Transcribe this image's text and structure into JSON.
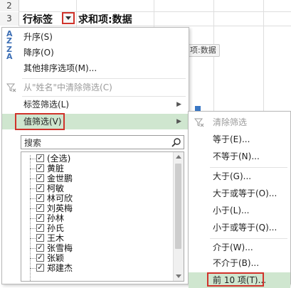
{
  "sheet": {
    "rows": [
      "2",
      "3"
    ],
    "row_label_cell": "行标签",
    "sum_header_cell": "求和项:数据",
    "field_chip": "项:数据"
  },
  "menu": {
    "items": [
      {
        "icon": "A↓Z",
        "label": "升序(S)",
        "enabled": true
      },
      {
        "icon": "Z↓A",
        "label": "降序(O)",
        "enabled": true
      },
      {
        "icon": "",
        "label": "其他排序选项(M)...",
        "enabled": true
      },
      {
        "icon": "filter-clear",
        "label": "从\"姓名\"中清除筛选(C)",
        "enabled": false
      },
      {
        "icon": "",
        "label": "标签筛选(L)",
        "enabled": true,
        "submenu": true
      },
      {
        "icon": "",
        "label": "值筛选(V)",
        "enabled": true,
        "submenu": true,
        "highlighted": true
      }
    ],
    "search_placeholder": "搜索",
    "list": [
      {
        "label": "(全选)",
        "checked": true
      },
      {
        "label": "黄脏",
        "checked": true
      },
      {
        "label": "金世鹏",
        "checked": true
      },
      {
        "label": "柯敏",
        "checked": true
      },
      {
        "label": "林可欣",
        "checked": true
      },
      {
        "label": "刘英梅",
        "checked": true
      },
      {
        "label": "孙林",
        "checked": true
      },
      {
        "label": "孙氏",
        "checked": true
      },
      {
        "label": "王木",
        "checked": true
      },
      {
        "label": "张雪梅",
        "checked": true
      },
      {
        "label": "张颖",
        "checked": true
      },
      {
        "label": "郑建杰",
        "checked": true
      }
    ]
  },
  "submenu": {
    "items": [
      {
        "label": "清除筛选",
        "enabled": false
      },
      {
        "label": "等于(E)...",
        "enabled": true
      },
      {
        "label": "不等于(N)...",
        "enabled": true
      },
      {
        "label": "大于(G)...",
        "enabled": true
      },
      {
        "label": "大于或等于(O)...",
        "enabled": true
      },
      {
        "label": "小于(L)...",
        "enabled": true
      },
      {
        "label": "小于或等于(Q)...",
        "enabled": true
      },
      {
        "label": "介于(W)...",
        "enabled": true
      },
      {
        "label": "不介于(B)...",
        "enabled": true
      },
      {
        "label": "前 10 项(T)...",
        "enabled": true,
        "highlighted": true
      }
    ]
  },
  "colors": {
    "highlight": "#cfe6cf",
    "annotation_red": "#d0332b",
    "accent_blue": "#3a77c4"
  }
}
